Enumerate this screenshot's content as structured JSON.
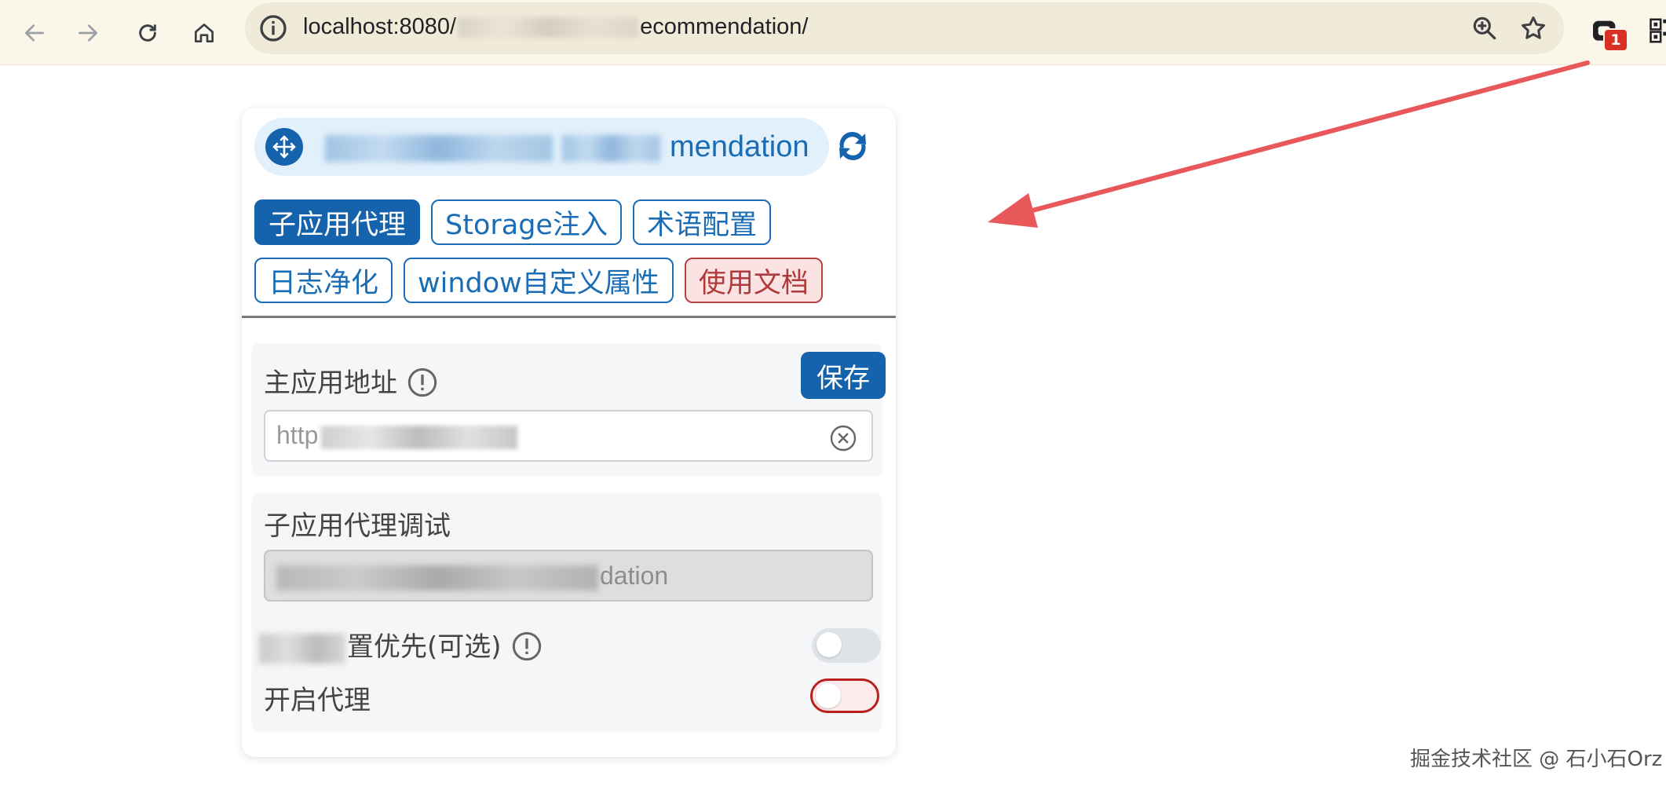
{
  "browser": {
    "url_prefix": "localhost:8080/",
    "url_suffix": "ecommendation/",
    "extension_badge": "1"
  },
  "panel": {
    "title_suffix": "mendation",
    "tabs_row1": [
      "子应用代理",
      "Storage注入",
      "术语配置"
    ],
    "tabs_row2": [
      "日志净化",
      "window自定义属性",
      "使用文档"
    ],
    "main_app": {
      "label": "主应用地址",
      "save_label": "保存",
      "input_value": "http"
    },
    "sub_app": {
      "label": "子应用代理调试",
      "disabled_value_suffix": "dation",
      "priority_label_suffix": "置优先(可选)",
      "proxy_label": "开启代理"
    }
  },
  "watermark": "掘金技术社区 @ 石小石Orz",
  "colors": {
    "accent": "#1563ad",
    "doc_tab": "#b03a3a",
    "arrow": "#e8585a"
  }
}
